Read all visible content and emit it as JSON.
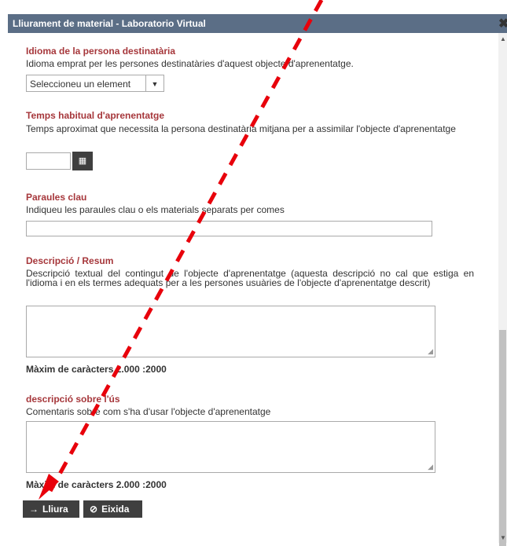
{
  "window": {
    "title": "Lliurament de material - Laboratorio Virtual",
    "close_glyph": "✖"
  },
  "form": {
    "language": {
      "label": "Idioma de la persona destinatària",
      "help": "Idioma emprat per les persones destinatàries d'aquest objecte d'aprenentatge.",
      "selected": "Seleccioneu un element",
      "arrow_glyph": "▼"
    },
    "time": {
      "label": "Temps habitual d'aprenentatge",
      "help": "Temps aproximat que necessita la persona destinatària mitjana per a assimilar l'objecte d'aprenentatge",
      "value": "",
      "calendar_icon": "calendar-icon",
      "calendar_glyph": "▦"
    },
    "keywords": {
      "label": "Paraules clau",
      "help": "Indiqueu les paraules clau o els materials separats per comes",
      "value": ""
    },
    "description": {
      "label": "Descripció / Resum",
      "help": "Descripció textual del contingut de l'objecte d'aprenentatge (aquesta descripció no cal que estiga en l'idioma i en els termes adequats per a les persones usuàries de l'objecte d'aprenentatge descrit)",
      "value": "",
      "max_note": "Màxim de caràcters 2.000 :2000"
    },
    "usage": {
      "label": "descripció sobre l'ús",
      "help": "Comentaris sobre com s'ha d'usar l'objecte d'aprenentatge",
      "value": "",
      "max_note": "Màxim de caràcters 2.000 :2000"
    }
  },
  "buttons": {
    "submit": {
      "icon": "arrow-right-icon",
      "glyph": "→",
      "label": "Lliura"
    },
    "exit": {
      "icon": "ban-icon",
      "glyph": "⊘",
      "label": "Eixida"
    }
  },
  "annotation": {
    "arrow_color": "#e8000b",
    "arrow_style": "dashed",
    "points_to": "Lliura button"
  },
  "colors": {
    "titlebar": "#5b6e86",
    "field_label": "#a6373b",
    "button_bg": "#3f3f3f"
  }
}
